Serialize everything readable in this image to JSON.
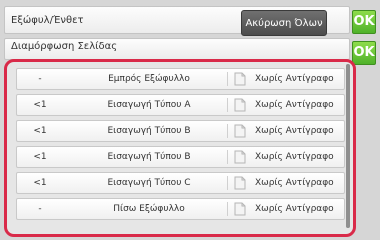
{
  "header": {
    "insert_label": "Εξώφυλ/Ένθετ",
    "page_layout_label": "Διαμόρφωση Σελίδας",
    "cancel_all_label": "Ακύρωση Όλων",
    "ok_label": "OK"
  },
  "list": {
    "items": [
      {
        "count": "-",
        "type": "Εμπρός Εξώφυλλο",
        "copy": "Χωρίς Αντίγραφο"
      },
      {
        "count": "<1",
        "type": "Εισαγωγή Τύπου A",
        "copy": "Χωρίς Αντίγραφο"
      },
      {
        "count": "<1",
        "type": "Εισαγωγή Τύπου B",
        "copy": "Χωρίς Αντίγραφο"
      },
      {
        "count": "<1",
        "type": "Εισαγωγή Τύπου B",
        "copy": "Χωρίς Αντίγραφο"
      },
      {
        "count": "<1",
        "type": "Εισαγωγή Τύπου C",
        "copy": "Χωρίς Αντίγραφο"
      },
      {
        "count": "-",
        "type": "Πίσω Εξώφυλλο",
        "copy": "Χωρίς Αντίγραφο"
      }
    ]
  },
  "colors": {
    "ok_green": "#5cc232",
    "highlight_red": "#d92a49",
    "cancel_button": "#5a5a5a"
  },
  "icons": {
    "copy_icon": "document-copy-icon"
  }
}
